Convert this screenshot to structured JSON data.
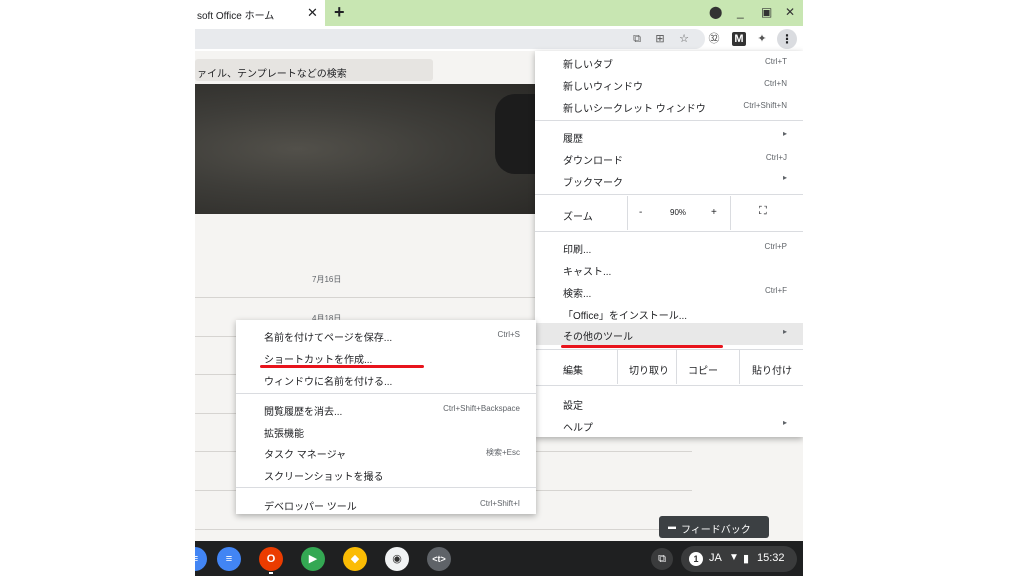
{
  "browser": {
    "tab_title": "soft Office ホーム",
    "tab_close": "✕",
    "new_tab": "+",
    "window_controls": [
      "⬤",
      "_",
      "▣",
      "✕"
    ],
    "toolbar_icons": [
      "⧉",
      "⊞",
      "☆",
      "㉜",
      "M",
      "✦"
    ],
    "menu_button": "⋮"
  },
  "page": {
    "search_placeholder": "ァイル、テンプレートなどの検索",
    "dates": [
      "7月16日",
      "4月18日"
    ]
  },
  "menu": {
    "new_tab": {
      "label": "新しいタブ",
      "shortcut": "Ctrl+T"
    },
    "new_window": {
      "label": "新しいウィンドウ",
      "shortcut": "Ctrl+N"
    },
    "incognito": {
      "label": "新しいシークレット ウィンドウ",
      "shortcut": "Ctrl+Shift+N"
    },
    "history": {
      "label": "履歴",
      "arrow": "▸"
    },
    "downloads": {
      "label": "ダウンロード",
      "shortcut": "Ctrl+J"
    },
    "bookmarks": {
      "label": "ブックマーク",
      "arrow": "▸"
    },
    "zoom": {
      "label": "ズーム",
      "minus": "-",
      "value": "90%",
      "plus": "+",
      "fullscreen": "⛶"
    },
    "print": {
      "label": "印刷...",
      "shortcut": "Ctrl+P"
    },
    "cast": {
      "label": "キャスト..."
    },
    "find": {
      "label": "検索...",
      "shortcut": "Ctrl+F"
    },
    "install": {
      "label": "「Office」をインストール..."
    },
    "more_tools": {
      "label": "その他のツール",
      "arrow": "▸"
    },
    "edit": {
      "label": "編集",
      "cut": "切り取り",
      "copy": "コピー",
      "paste": "貼り付け"
    },
    "settings": {
      "label": "設定"
    },
    "help": {
      "label": "ヘルプ",
      "arrow": "▸"
    }
  },
  "submenu": {
    "save_page": {
      "label": "名前を付けてページを保存...",
      "shortcut": "Ctrl+S"
    },
    "create_shortcut": {
      "label": "ショートカットを作成..."
    },
    "name_window": {
      "label": "ウィンドウに名前を付ける..."
    },
    "clear_data": {
      "label": "閲覧履歴を消去...",
      "shortcut": "Ctrl+Shift+Backspace"
    },
    "extensions": {
      "label": "拡張機能"
    },
    "task_manager": {
      "label": "タスク マネージャ",
      "shortcut": "検索+Esc"
    },
    "screenshot": {
      "label": "スクリーンショットを撮る"
    },
    "devtools": {
      "label": "デベロッパー ツール",
      "shortcut": "Ctrl+Shift+I"
    }
  },
  "feedback": {
    "icon": "▬",
    "label": "フィードバック"
  },
  "shelf": {
    "apps": [
      {
        "glyph": "≡",
        "color": "#4285f4"
      },
      {
        "glyph": "O",
        "color": "#eb3c00"
      },
      {
        "glyph": "▶",
        "color": "#34a853"
      },
      {
        "glyph": "◆",
        "color": "#fbbc04"
      },
      {
        "glyph": "◉",
        "color": "#f1f3f4"
      },
      {
        "glyph": "<t>",
        "color": "#5f6368"
      }
    ],
    "holding_space": "⧉",
    "status": {
      "notification": "1",
      "ime": "JA",
      "wifi": "▼",
      "battery": "▮",
      "time": "15:32"
    }
  },
  "colors": {
    "highlight": "#e8141c",
    "titlebar": "#c8e6b2"
  }
}
